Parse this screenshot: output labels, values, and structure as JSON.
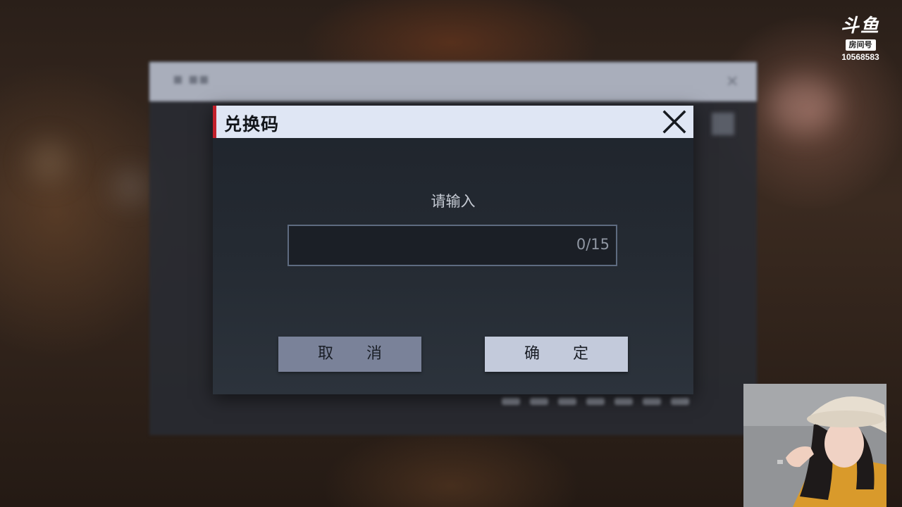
{
  "dialog": {
    "title": "兑换码",
    "close_icon": "close-icon",
    "prompt": "请输入",
    "input": {
      "value": "",
      "placeholder": "",
      "counter": "0/15"
    },
    "buttons": {
      "cancel": "取 消",
      "confirm": "确 定"
    },
    "colors": {
      "header_bg": "#dfe6f4",
      "accent": "#c2202b",
      "cancel_bg": "#7a8299",
      "confirm_bg": "#c3cadb"
    }
  },
  "overlay": {
    "logo_mark": "斗鱼",
    "logo_tag": "房间号",
    "room_id": "10568583"
  }
}
